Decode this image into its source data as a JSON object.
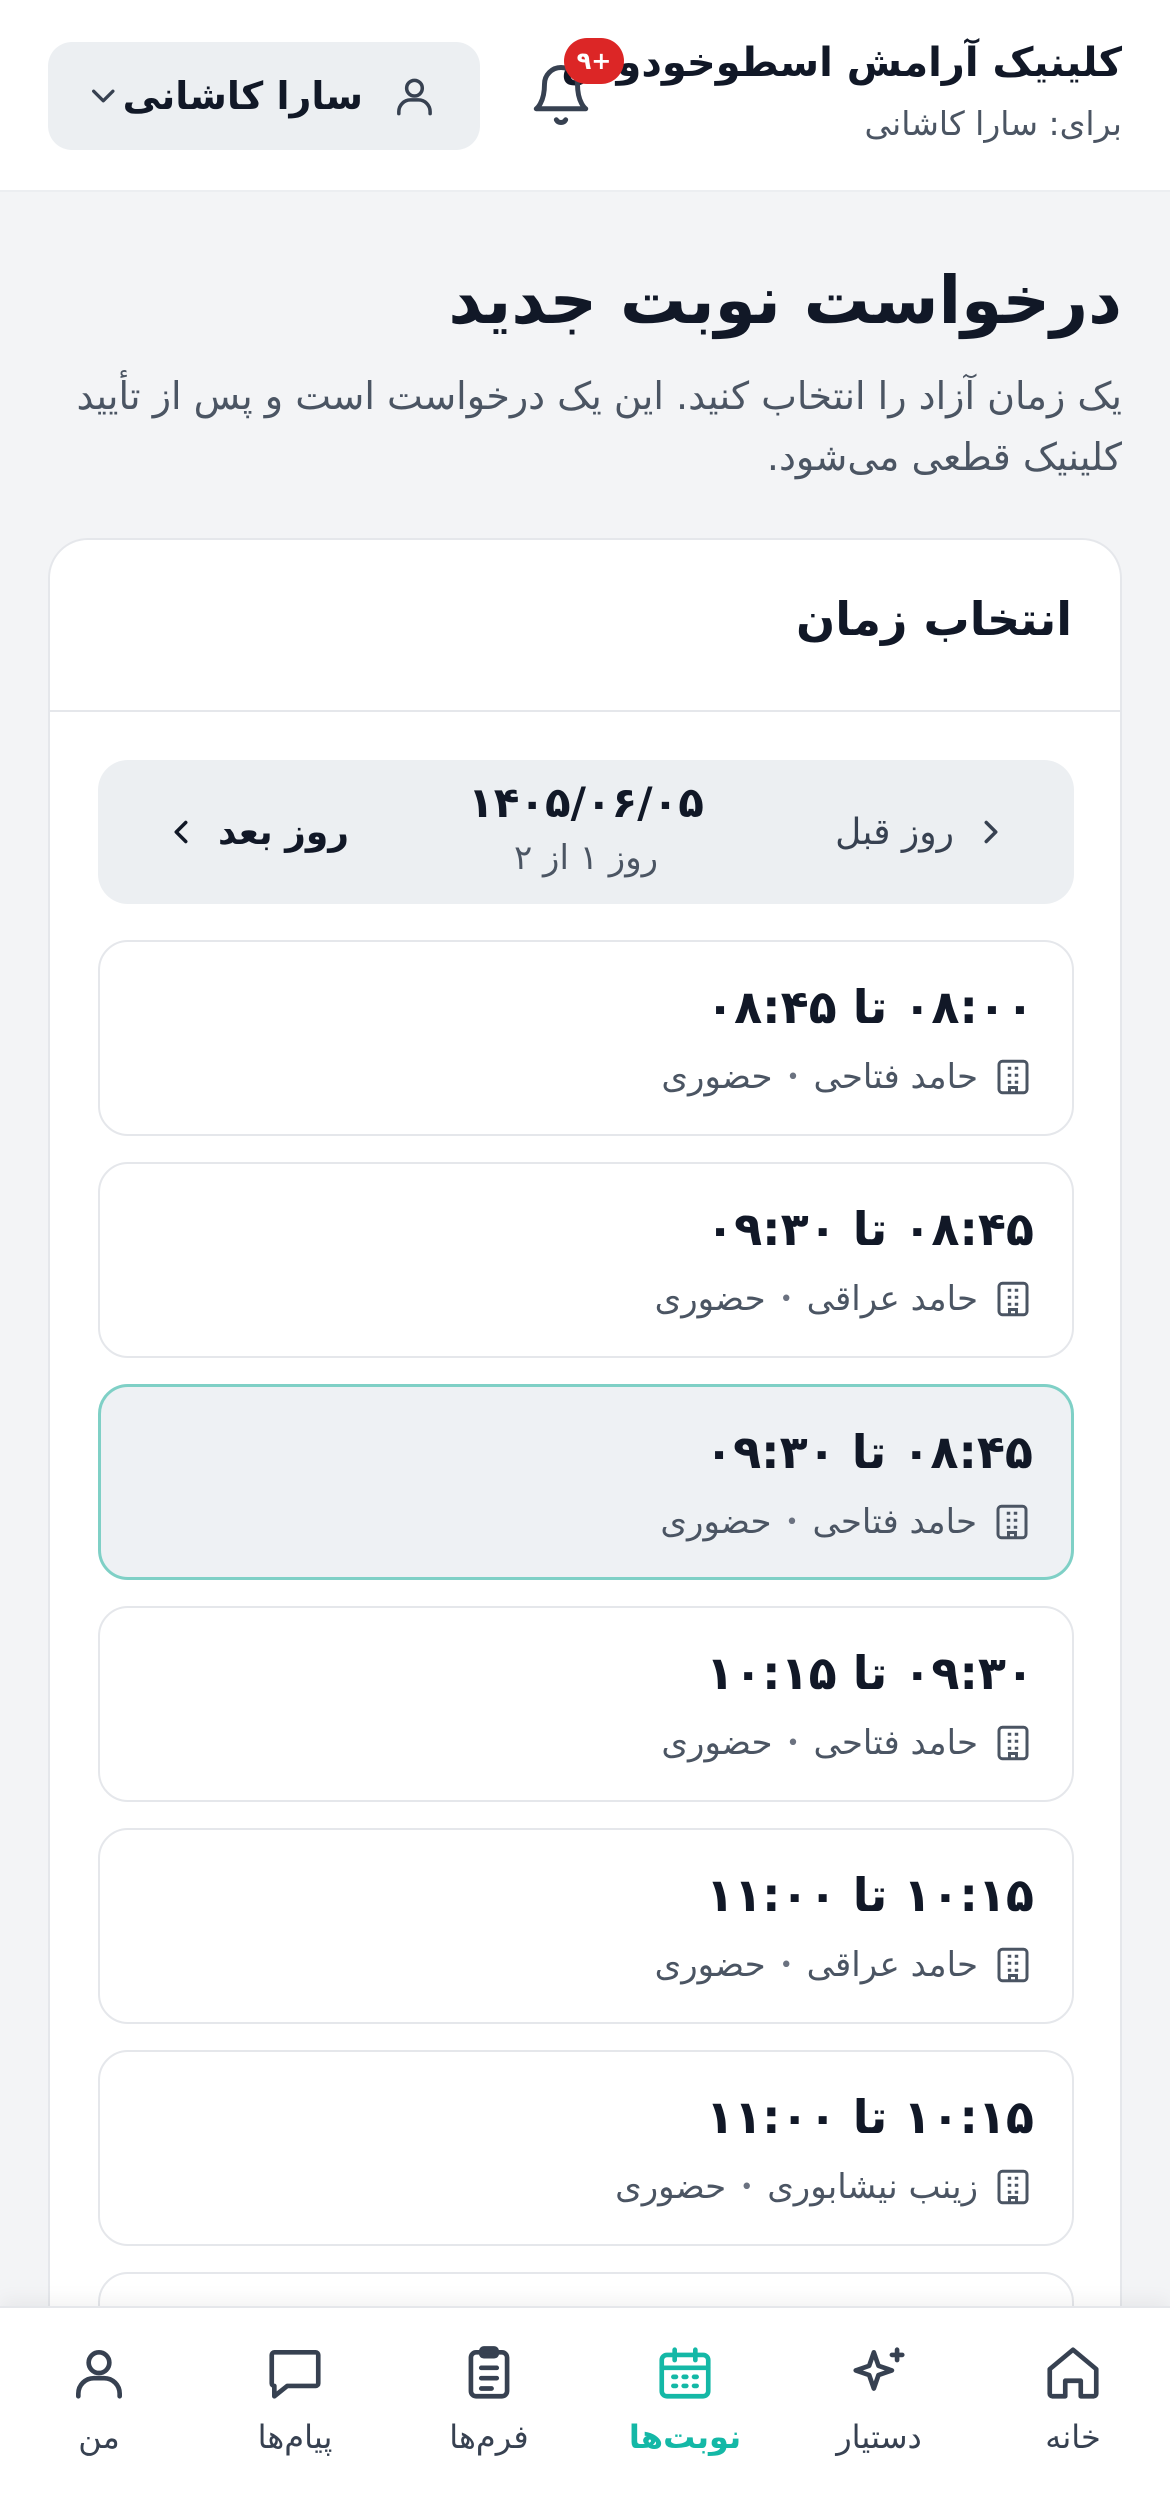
{
  "header": {
    "clinic_name": "کلینیک آرامش اسطوخودوس",
    "for_line": "برای: سارا کاشانی",
    "notification_badge": "۹+",
    "profile_label": "سارا کاشانی"
  },
  "page": {
    "title": "درخواست نوبت جدید",
    "description": "یک زمان آزاد را انتخاب کنید. این یک درخواست است و پس از تأیید کلینیک قطعی می‌شود."
  },
  "card": {
    "title": "انتخاب زمان",
    "day_nav": {
      "prev_label": "روز قبل",
      "next_label": "روز بعد",
      "date": "۱۴۰۵/۰۶/۰۵",
      "day_count": "روز ۱ از ۲"
    },
    "slots": [
      {
        "time": "۰۸:۰۰ تا ۰۸:۴۵",
        "doctor": "حامد فتاحی",
        "mode": "حضوری",
        "selected": false
      },
      {
        "time": "۰۸:۴۵ تا ۰۹:۳۰",
        "doctor": "حامد عراقی",
        "mode": "حضوری",
        "selected": false
      },
      {
        "time": "۰۸:۴۵ تا ۰۹:۳۰",
        "doctor": "حامد فتاحی",
        "mode": "حضوری",
        "selected": true
      },
      {
        "time": "۰۹:۳۰ تا ۱۰:۱۵",
        "doctor": "حامد فتاحی",
        "mode": "حضوری",
        "selected": false
      },
      {
        "time": "۱۰:۱۵ تا ۱۱:۰۰",
        "doctor": "حامد عراقی",
        "mode": "حضوری",
        "selected": false
      },
      {
        "time": "۱۰:۱۵ تا ۱۱:۰۰",
        "doctor": "زینب نیشابوری",
        "mode": "حضوری",
        "selected": false
      }
    ]
  },
  "bottom_nav": {
    "items": [
      {
        "label": "خانه",
        "icon": "home-icon",
        "active": false
      },
      {
        "label": "دستیار",
        "icon": "sparkle-icon",
        "active": false
      },
      {
        "label": "نوبت‌ها",
        "icon": "calendar-icon",
        "active": true
      },
      {
        "label": "فرم‌ها",
        "icon": "clipboard-icon",
        "active": false
      },
      {
        "label": "پیام‌ها",
        "icon": "message-icon",
        "active": false
      },
      {
        "label": "من",
        "icon": "user-icon",
        "active": false
      }
    ]
  },
  "colors": {
    "accent": "#14b8a6",
    "selected_border": "#7fd0c6",
    "badge": "#dc2626"
  }
}
